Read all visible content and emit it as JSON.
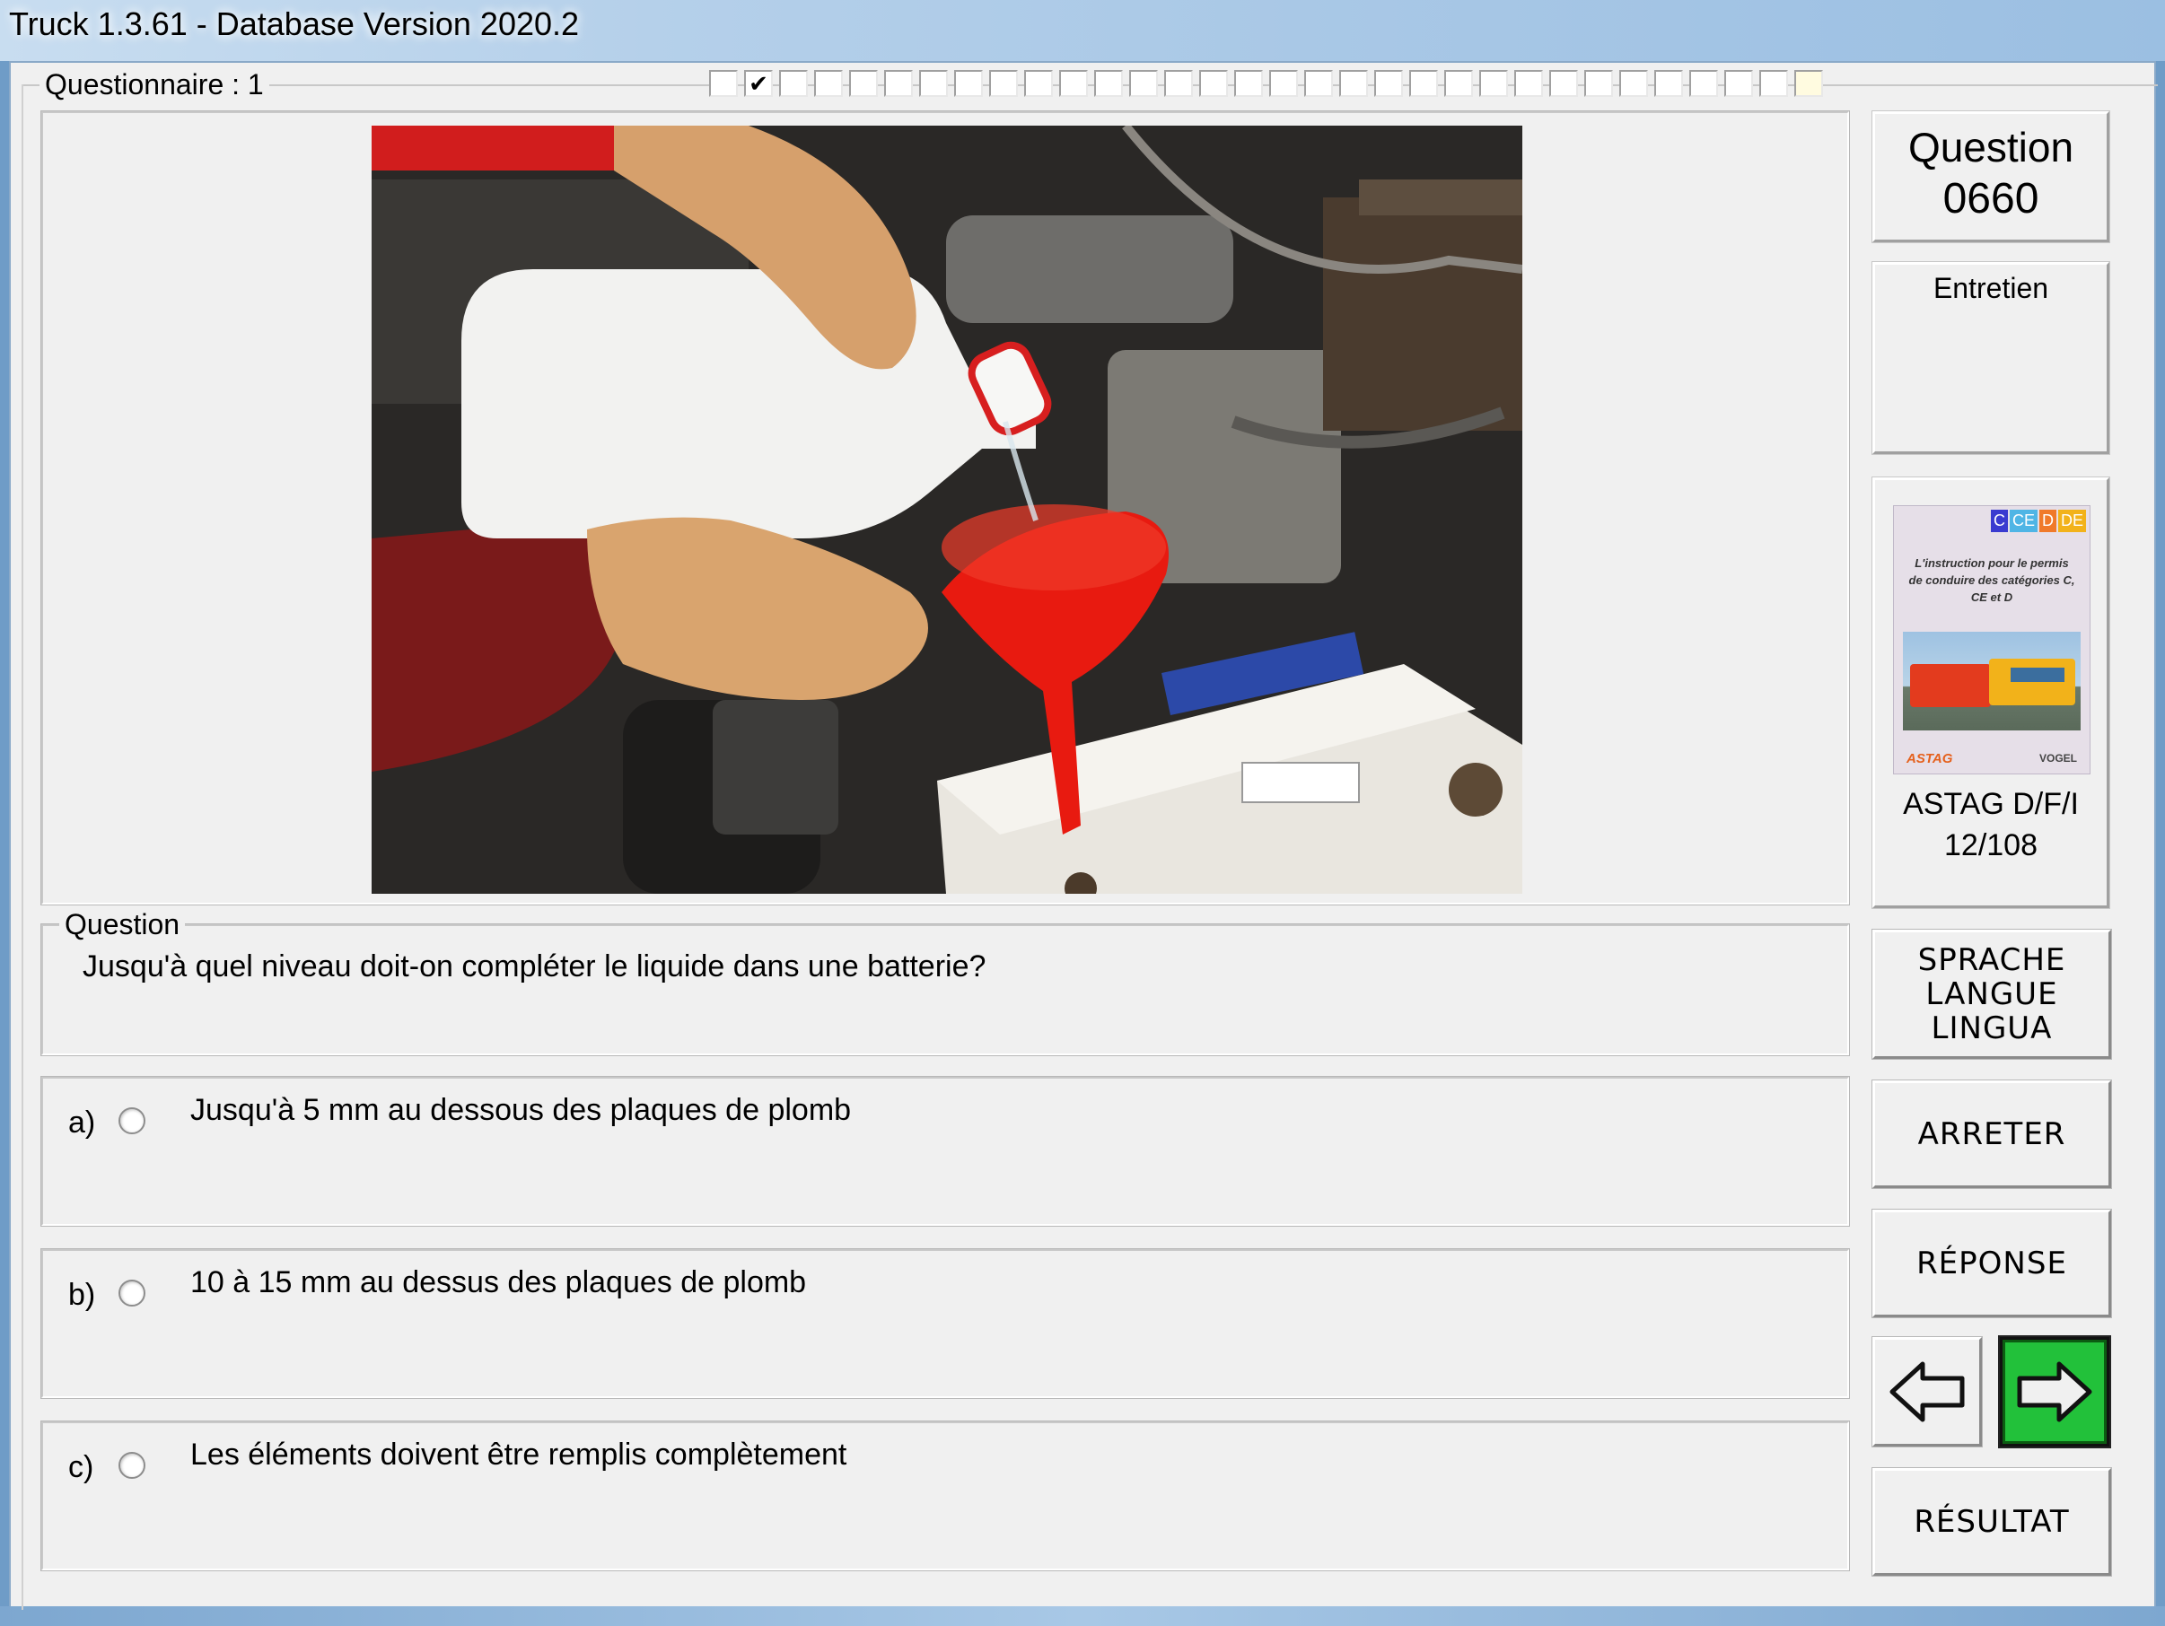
{
  "window": {
    "title": "Truck 1.3.61 - Database Version 2020.2"
  },
  "questionnaire": {
    "label": "Questionnaire : 1",
    "progress_total": 32,
    "progress_checked_index": 1,
    "progress_current_index": 31,
    "check_glyph": "✔"
  },
  "question": {
    "number_title": "Question",
    "number": "0660",
    "category": "Entretien",
    "legend": "Question",
    "text": "Jusqu'à quel niveau doit-on compléter le liquide dans une batterie?"
  },
  "answers": [
    {
      "letter": "a)",
      "text": "Jusqu'à 5 mm au dessous des plaques de plomb"
    },
    {
      "letter": "b)",
      "text": "10 à 15 mm au dessus des plaques de plomb"
    },
    {
      "letter": "c)",
      "text": "Les éléments doivent être remplis complètement"
    }
  ],
  "book": {
    "badges": [
      "C",
      "CE",
      "D",
      "DE"
    ],
    "cover_text": "L'instruction pour le permis de conduire des catégories C, CE et D",
    "publisher_left": "ASTAG",
    "publisher_right": "VOGEL",
    "source_line1": "ASTAG D/F/I",
    "source_line2": "12/108"
  },
  "buttons": {
    "language": [
      "SPRACHE",
      "LANGUE",
      "LINGUA"
    ],
    "stop": "ARRETER",
    "answer": "RÉPONSE",
    "result": "RÉSULTAT"
  },
  "icons": {
    "prev": "arrow-left-icon",
    "next": "arrow-right-icon"
  },
  "colors": {
    "next_button": "#22c13a",
    "funnel": "#e81a10"
  }
}
